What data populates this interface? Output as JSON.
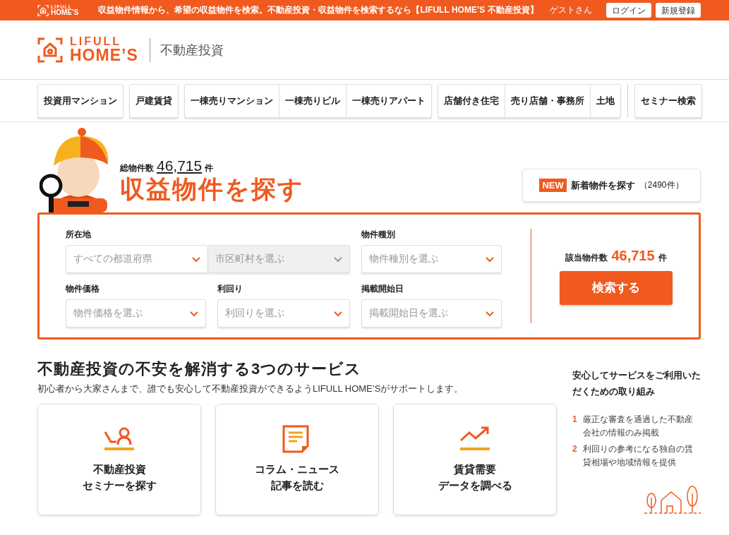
{
  "top_bar": {
    "logo": {
      "line1": "LIFULL",
      "line2": "HOME’S"
    },
    "tagline": "収益物件情報から、希望の収益物件を検索。不動産投資・収益物件を検索するなら【LIFULL HOME’S 不動産投資】",
    "user": "ゲストさん",
    "buttons": [
      "ログイン",
      "新規登録"
    ]
  },
  "header": {
    "logo": {
      "line1": "LIFULL",
      "line2": "HOME’S"
    },
    "section": "不動産投資"
  },
  "nav": {
    "groups": [
      {
        "items": [
          "投資用マンション"
        ]
      },
      {
        "items": [
          "戸建賃貸"
        ]
      },
      {
        "items": [
          "一棟売りマンション",
          "一棟売りビル",
          "一棟売りアパート"
        ]
      },
      {
        "items": [
          "店舗付き住宅",
          "売り店舗・事務所",
          "土地"
        ]
      },
      {
        "items": [
          "セミナー検索"
        ],
        "separated": true
      }
    ]
  },
  "hero": {
    "total_label": "総物件数",
    "total": "46,715",
    "total_unit": "件",
    "title": "収益物件を探す",
    "new_button": {
      "badge": "NEW",
      "label": "新着物件を探す",
      "count": "（2490件）"
    }
  },
  "search": {
    "rows": [
      {
        "fields": [
          {
            "label": "所在地",
            "selects": [
              {
                "placeholder": "すべての都道府県",
                "disabled": false
              },
              {
                "placeholder": "市区町村を選ぶ",
                "disabled": true
              }
            ]
          },
          {
            "label": "物件種別",
            "selects": [
              {
                "placeholder": "物件種別を選ぶ",
                "disabled": false
              }
            ]
          }
        ]
      },
      {
        "fields": [
          {
            "label": "物件価格",
            "selects": [
              {
                "placeholder": "物件価格を選ぶ",
                "disabled": false
              }
            ]
          },
          {
            "label": "利回り",
            "selects": [
              {
                "placeholder": "利回りを選ぶ",
                "disabled": false
              }
            ]
          },
          {
            "label": "掲載開始日",
            "selects": [
              {
                "placeholder": "掲載開始日を選ぶ",
                "disabled": false
              }
            ]
          }
        ]
      }
    ],
    "result_label": "該当物件数",
    "result_count": "46,715",
    "result_unit": "件",
    "button": "検索する"
  },
  "services": {
    "title": "不動産投資の不安を解消する3つのサービス",
    "subtitle": "初心者から大家さんまで、誰でも安心して不動産投資ができるようLIFULL HOME’Sがサポートします。",
    "cards": [
      {
        "kind": "seminar",
        "lines": [
          "不動産投資",
          "セミナーを探す"
        ]
      },
      {
        "kind": "column",
        "lines": [
          "コラム・ニュース",
          "記事を読む"
        ]
      },
      {
        "kind": "data",
        "lines": [
          "賃貸需要",
          "データを調べる"
        ]
      }
    ],
    "aside": {
      "title": "安心してサービスをご利用いただくための取り組み",
      "points": [
        {
          "number": "1",
          "text": "厳正な審査を通過した不動産会社の情報のみ掲載"
        },
        {
          "number": "2",
          "text": "利回りの参考になる独自の賃貸相場や地域情報を提供"
        }
      ]
    }
  }
}
